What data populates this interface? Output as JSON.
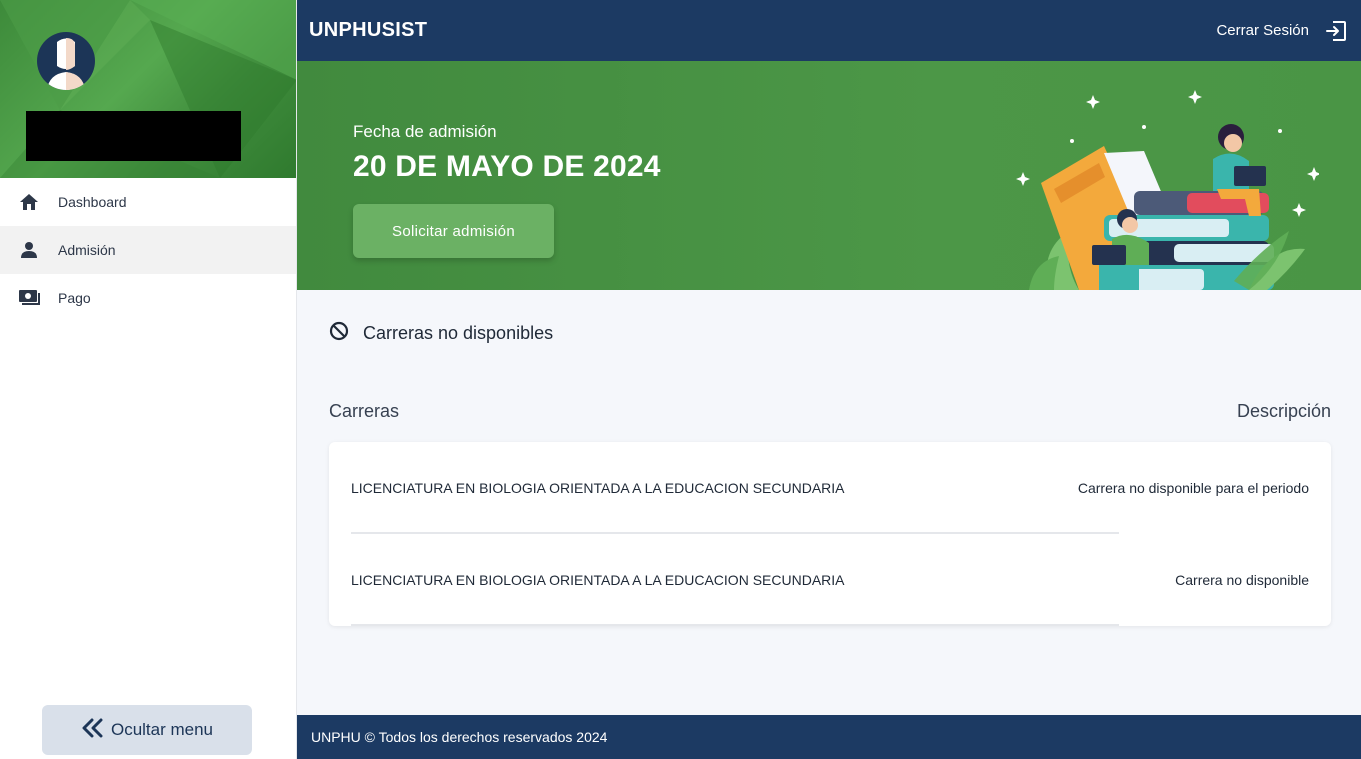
{
  "app": {
    "brand": "UNPHUSIST"
  },
  "header": {
    "logout_label": "Cerrar Sesión"
  },
  "sidebar": {
    "items": [
      {
        "label": "Dashboard",
        "icon": "home-icon"
      },
      {
        "label": "Admisión",
        "icon": "person-icon"
      },
      {
        "label": "Pago",
        "icon": "payment-icon"
      }
    ],
    "active_index": 1,
    "hide_menu_label": "Ocultar menu"
  },
  "hero": {
    "label": "Fecha de admisión",
    "date": "20 DE MAYO DE 2024",
    "button_label": "Solicitar admisión"
  },
  "careers": {
    "section_title": "Carreras no disponibles",
    "columns": {
      "career": "Carreras",
      "description": "Descripción"
    },
    "rows": [
      {
        "career": "LICENCIATURA EN BIOLOGIA ORIENTADA A LA EDUCACION SECUNDARIA",
        "description": "Carrera no disponible para el periodo"
      },
      {
        "career": "LICENCIATURA EN BIOLOGIA ORIENTADA A LA EDUCACION SECUNDARIA",
        "description": "Carrera no disponible"
      }
    ]
  },
  "footer": {
    "text": "UNPHU © Todos los derechos reservados 2024"
  },
  "colors": {
    "navy": "#1c3a63",
    "green": "#4a9545",
    "button_green": "#6bb164"
  }
}
